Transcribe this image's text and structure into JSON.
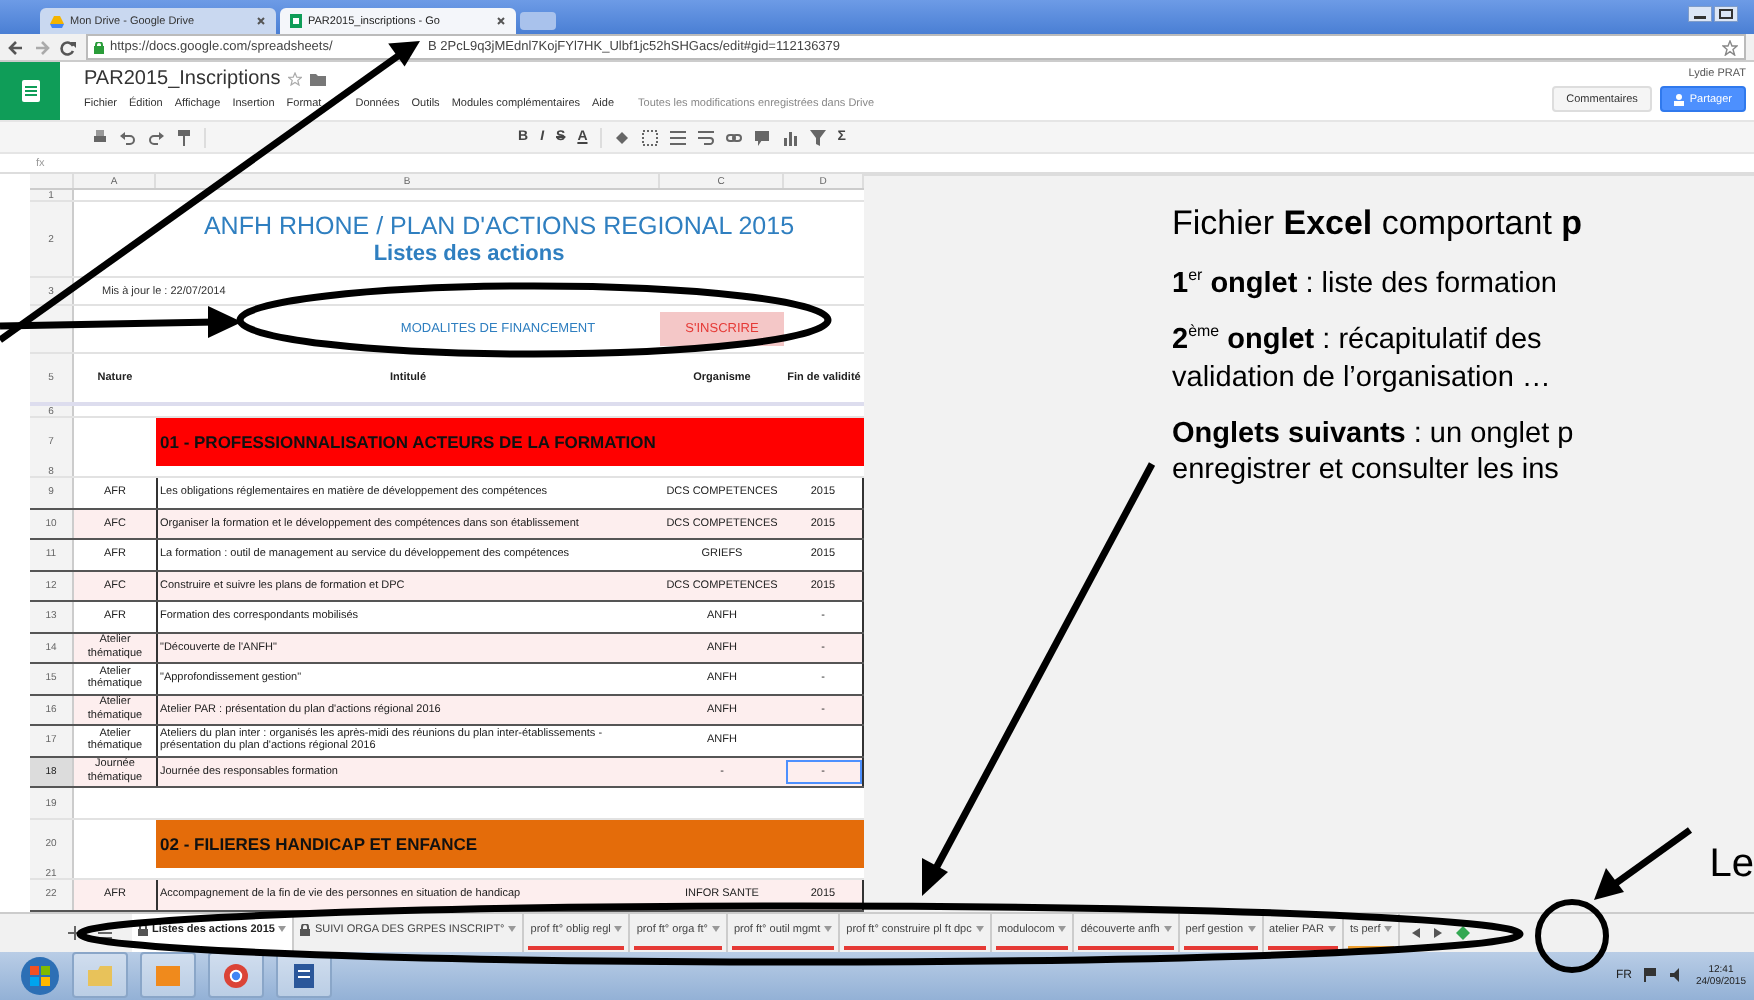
{
  "browser": {
    "tabs": [
      {
        "title": "Mon Drive - Google Drive",
        "selected": false
      },
      {
        "title": "PAR2015_inscriptions - Go",
        "selected": true
      }
    ],
    "url_parts": [
      "https://docs.google.com/spreadsheets/",
      "B 2PcL9q3jMEdnl7KojFYl7HK_Ulbf1jc52hSHGacs/edit#gid=112136379"
    ]
  },
  "docs": {
    "title": "PAR2015_Inscriptions",
    "menu": [
      "Fichier",
      "Édition",
      "Affichage",
      "Insertion",
      "Format",
      "Données",
      "Outils",
      "Modules complémentaires",
      "Aide"
    ],
    "save_status": "Toutes les modifications enregistrées dans Drive",
    "user": "Lydie PRAT",
    "buttons": [
      {
        "label": "Commentaires",
        "kind": "plain"
      },
      {
        "label": "Partager",
        "kind": "primary"
      }
    ]
  },
  "toolbar": {
    "glyphs": [
      "B",
      "I",
      "S",
      "A",
      "Σ"
    ]
  },
  "formula_bar": {
    "label": "fx"
  },
  "sheet": {
    "columns": [
      "A",
      "B",
      "C",
      "D"
    ],
    "rows": [
      {
        "number": "1",
        "kind": "blank"
      },
      {
        "number": "2",
        "kind": "title",
        "title": "ANFH RHONE / PLAN D'ACTIONS REGIONAL 2015",
        "subtitle": "Listes des actions"
      },
      {
        "number": "3",
        "kind": "note",
        "text": "Mis à jour le : 22/07/2014"
      },
      {
        "kind": "links",
        "link": "MODALITES DE FINANCEMENT",
        "button": "S'INSCRIRE"
      },
      {
        "number": "5",
        "kind": "header",
        "cells": [
          "Nature",
          "Intitulé",
          "Organisme",
          "Fin de validité"
        ]
      },
      {
        "number": "6",
        "kind": "blank"
      },
      {
        "number": "7",
        "kind": "section",
        "text": "01 - PROFESSIONNALISATION ACTEURS DE LA FORMATION",
        "color": "#ff0000"
      },
      {
        "number": "8",
        "kind": "blank"
      },
      {
        "number": "9",
        "kind": "action",
        "cells": [
          "AFR",
          "Les obligations réglementaires en matière de développement des compétences",
          "DCS COMPETENCES",
          "2015"
        ],
        "selected": false
      },
      {
        "number": "10",
        "kind": "action",
        "cells": [
          "AFC",
          "Organiser la formation et le développement des compétences dans son établissement",
          "DCS COMPETENCES",
          "2015"
        ],
        "selected": false
      },
      {
        "number": "11",
        "kind": "action",
        "cells": [
          "AFR",
          "La formation : outil de management au service du développement des compétences",
          "GRIEFS",
          "2015"
        ],
        "selected": false
      },
      {
        "number": "12",
        "kind": "action",
        "cells": [
          "AFC",
          "Construire et suivre les plans de formation et DPC",
          "DCS COMPETENCES",
          "2015"
        ],
        "selected": false
      },
      {
        "number": "13",
        "kind": "action",
        "cells": [
          "AFR",
          "Formation des correspondants mobilisés",
          "ANFH",
          "-"
        ],
        "selected": false
      },
      {
        "number": "14",
        "kind": "action",
        "cells": [
          "Atelier thématique",
          "\"Découverte de l'ANFH\"",
          "ANFH",
          "-"
        ],
        "selected": false
      },
      {
        "number": "15",
        "kind": "action",
        "cells": [
          "Atelier thématique",
          "\"Approfondissement gestion\"",
          "ANFH",
          "-"
        ],
        "selected": false
      },
      {
        "number": "16",
        "kind": "action",
        "cells": [
          "Atelier thématique",
          "Atelier PAR : présentation du plan d'actions régional 2016",
          "ANFH",
          "-"
        ],
        "selected": false
      },
      {
        "number": "17",
        "kind": "action",
        "cells": [
          "Atelier thématique",
          "Ateliers du plan inter : organisés les après-midi des réunions du plan inter-établissements - présentation du plan d'actions régional 2016",
          "ANFH"
        ],
        "selected": false
      },
      {
        "number": "18",
        "kind": "action",
        "cells": [
          "Journée thématique",
          "Journée des responsables formation",
          "-",
          "-"
        ],
        "selected": true
      },
      {
        "number": "19",
        "kind": "empty"
      },
      {
        "number": "20",
        "kind": "section",
        "text": "02 - FILIERES HANDICAP ET ENFANCE",
        "color": "#e46c0a"
      },
      {
        "number": "21",
        "kind": "blank"
      },
      {
        "number": "22",
        "kind": "action",
        "cells": [
          "AFR",
          "Accompagnement de la fin de vie des personnes en situation de handicap",
          "INFOR SANTE",
          "2015"
        ],
        "selected": false
      }
    ]
  },
  "sheet_tabs": [
    {
      "label": "Listes des actions 2015",
      "selected": true,
      "locked": true
    },
    {
      "label": "SUIVI ORGA DES GRPES INSCRIPT°",
      "selected": false,
      "locked": true
    },
    {
      "label": "prof ft° oblig regl",
      "selected": false,
      "locked": false,
      "color": "#e53935"
    },
    {
      "label": "prof ft° orga ft°",
      "selected": false,
      "locked": false,
      "color": "#e53935"
    },
    {
      "label": "prof ft° outil mgmt",
      "selected": false,
      "locked": false,
      "color": "#e53935"
    },
    {
      "label": "prof ft° construire pl ft dpc",
      "selected": false,
      "locked": false,
      "color": "#e53935"
    },
    {
      "label": "modulocom",
      "selected": false,
      "locked": false,
      "color": "#e53935"
    },
    {
      "label": "découverte anfh",
      "selected": false,
      "locked": false,
      "color": "#e53935"
    },
    {
      "label": "perf gestion",
      "selected": false,
      "locked": false,
      "color": "#e53935"
    },
    {
      "label": "atelier PAR",
      "selected": false,
      "locked": false,
      "color": "#e53935"
    },
    {
      "label": "ts perf",
      "selected": false,
      "locked": false,
      "color": "#f0a030"
    }
  ],
  "taskbar": {
    "language": "FR",
    "time": "12:41",
    "date": "24/09/2015"
  },
  "annotation": {
    "paragraphs": [
      {
        "kind": "lead",
        "text": "Fichier **Excel** comportant **p**"
      },
      {
        "kind": "body",
        "text": "**1**$^{er}$ **onglet** : liste des formation"
      },
      {
        "kind": "body",
        "text": "**2**$^{ème}$ **onglet** : récapitulatif des\nvalidation de l’organisation …"
      },
      {
        "kind": "body",
        "text": "**Onglets suivants** : un onglet p\nenregistrer et consulter les ins"
      }
    ],
    "label": "Le"
  }
}
